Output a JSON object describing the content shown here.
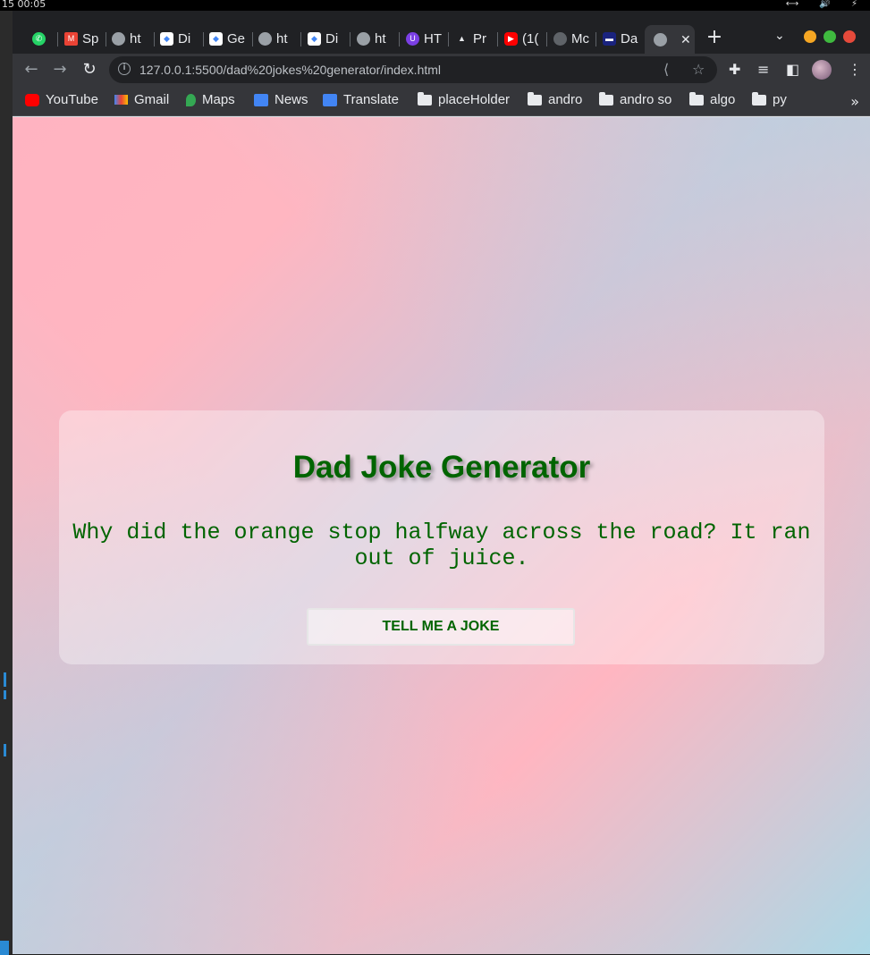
{
  "os": {
    "time": "15  00:05"
  },
  "browser": {
    "tabs": [
      {
        "label": "",
        "icon": "whatsapp-icon"
      },
      {
        "label": "Sp",
        "icon": "gmail-icon"
      },
      {
        "label": "ht",
        "icon": "globe-icon"
      },
      {
        "label": "Di",
        "icon": "codepen-icon"
      },
      {
        "label": "Ge",
        "icon": "codepen-icon"
      },
      {
        "label": "ht",
        "icon": "globe-icon"
      },
      {
        "label": "Di",
        "icon": "codepen-icon"
      },
      {
        "label": "ht",
        "icon": "globe-icon"
      },
      {
        "label": "HT",
        "icon": "shield-icon"
      },
      {
        "label": "Pr",
        "icon": "rocket-icon"
      },
      {
        "label": "(1(",
        "icon": "youtube-icon"
      },
      {
        "label": "Mc",
        "icon": "github-icon"
      },
      {
        "label": "Da",
        "icon": "ninja-icon"
      },
      {
        "label": "",
        "icon": "globe-icon",
        "active": true
      }
    ],
    "url": "127.0.0.1:5500/dad%20jokes%20generator/index.html",
    "bookmarks": [
      "YouTube",
      "Gmail",
      "Maps",
      "News",
      "Translate",
      "placeHolder",
      "andro",
      "andro so",
      "algo",
      "py"
    ]
  },
  "page": {
    "title": "Dad Joke Generator",
    "joke": "Why did the orange stop halfway across the road? It ran out of juice.",
    "button_label": "TELL ME A JOKE"
  },
  "colors": {
    "accent": "#006400",
    "bg_pink": "#ffb6c1",
    "bg_blue": "#add8e6"
  }
}
